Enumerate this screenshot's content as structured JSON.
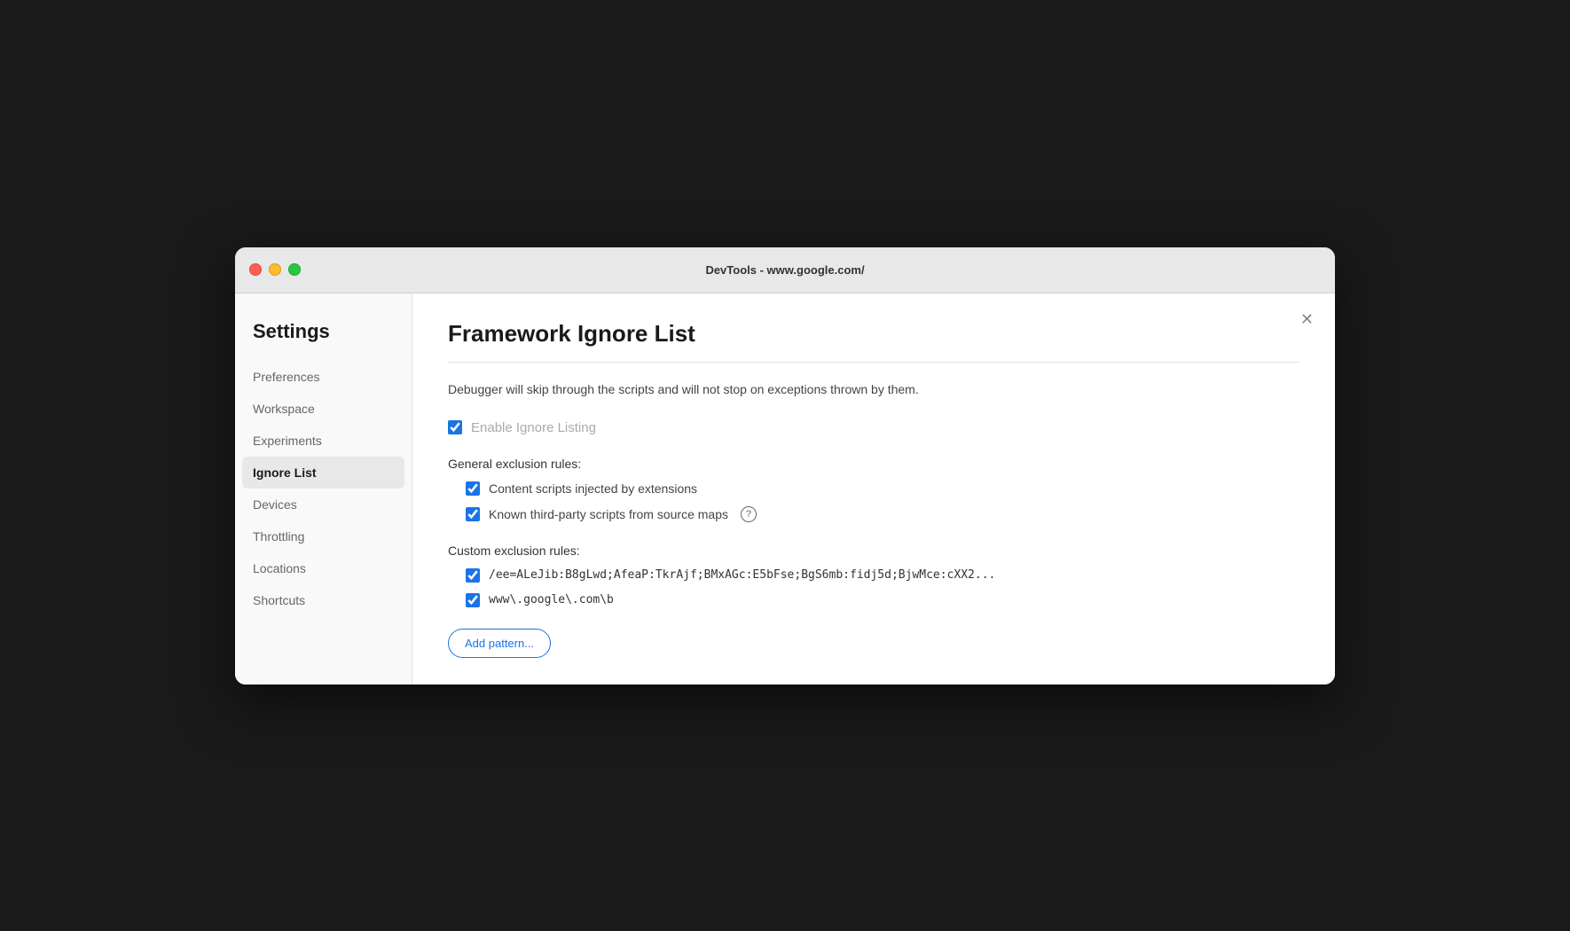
{
  "titlebar": {
    "title": "DevTools - www.google.com/"
  },
  "sidebar": {
    "heading": "Settings",
    "items": [
      {
        "id": "preferences",
        "label": "Preferences",
        "active": false
      },
      {
        "id": "workspace",
        "label": "Workspace",
        "active": false
      },
      {
        "id": "experiments",
        "label": "Experiments",
        "active": false
      },
      {
        "id": "ignore-list",
        "label": "Ignore List",
        "active": true
      },
      {
        "id": "devices",
        "label": "Devices",
        "active": false
      },
      {
        "id": "throttling",
        "label": "Throttling",
        "active": false
      },
      {
        "id": "locations",
        "label": "Locations",
        "active": false
      },
      {
        "id": "shortcuts",
        "label": "Shortcuts",
        "active": false
      }
    ]
  },
  "main": {
    "title": "Framework Ignore List",
    "description": "Debugger will skip through the scripts and will not stop on exceptions thrown by them.",
    "enable_ignore": {
      "label": "Enable Ignore Listing",
      "checked": true
    },
    "general_rules": {
      "heading": "General exclusion rules:",
      "items": [
        {
          "id": "content-scripts",
          "label": "Content scripts injected by extensions",
          "checked": true,
          "has_help": false
        },
        {
          "id": "third-party-scripts",
          "label": "Known third-party scripts from source maps",
          "checked": true,
          "has_help": true
        }
      ]
    },
    "custom_rules": {
      "heading": "Custom exclusion rules:",
      "items": [
        {
          "id": "custom-rule-1",
          "label": "/ee=ALeJib:B8gLwd;AfeaP:TkrAjf;BMxAGc:E5bFse;BgS6mb:fidj5d;BjwMce:cXX2...",
          "checked": true
        },
        {
          "id": "custom-rule-2",
          "label": "www\\.google\\.com\\b",
          "checked": true
        }
      ],
      "add_button_label": "Add pattern..."
    }
  },
  "close_button_label": "✕"
}
